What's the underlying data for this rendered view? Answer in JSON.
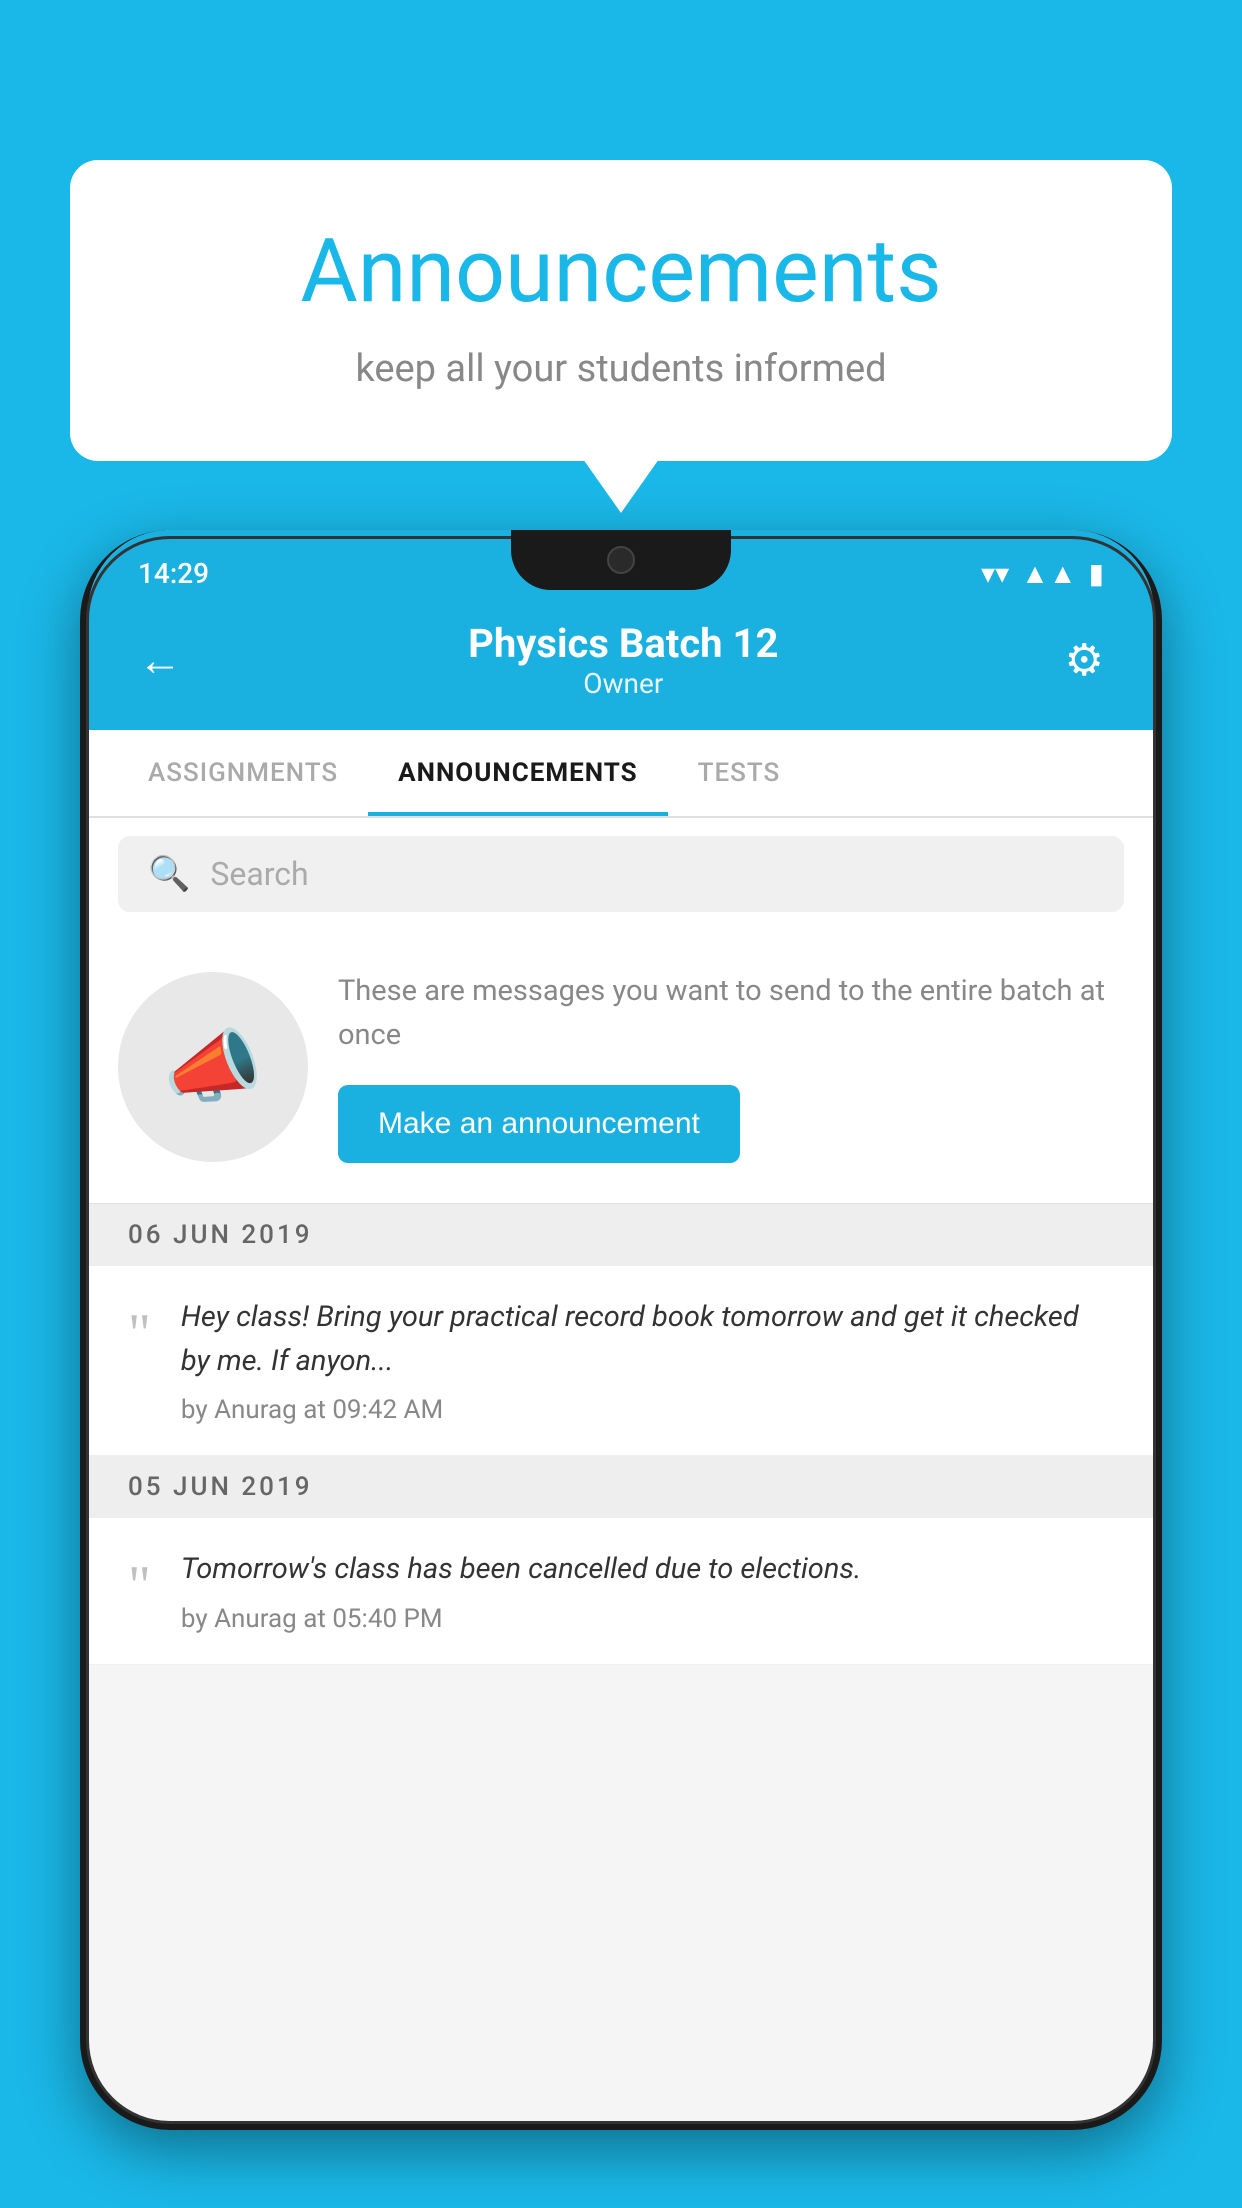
{
  "background_color": "#1ab8e8",
  "bubble": {
    "title": "Announcements",
    "subtitle": "keep all your students informed"
  },
  "phone": {
    "status_bar": {
      "time": "14:29"
    },
    "header": {
      "title": "Physics Batch 12",
      "subtitle": "Owner",
      "back_label": "←",
      "gear_label": "⚙"
    },
    "tabs": [
      {
        "label": "ASSIGNMENTS",
        "active": false
      },
      {
        "label": "ANNOUNCEMENTS",
        "active": true
      },
      {
        "label": "TESTS",
        "active": false
      }
    ],
    "search": {
      "placeholder": "Search"
    },
    "promo": {
      "description": "These are messages you want to send to the entire batch at once",
      "button_label": "Make an announcement"
    },
    "announcements": [
      {
        "date": "06  JUN  2019",
        "text": "Hey class! Bring your practical record book tomorrow and get it checked by me. If anyon...",
        "meta": "by Anurag at 09:42 AM"
      },
      {
        "date": "05  JUN  2019",
        "text": "Tomorrow's class has been cancelled due to elections.",
        "meta": "by Anurag at 05:40 PM"
      }
    ]
  }
}
